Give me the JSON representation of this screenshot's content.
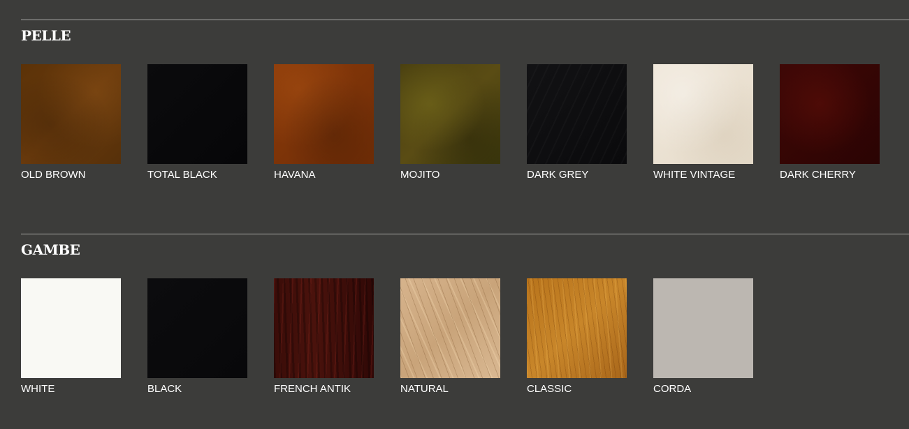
{
  "pelle": {
    "title": "PELLE",
    "items": [
      {
        "label": "OLD BROWN",
        "color": "#5e340a"
      },
      {
        "label": "TOTAL BLACK",
        "color": "#09090b"
      },
      {
        "label": "HAVANA",
        "color": "#7e340a"
      },
      {
        "label": "MOJITO",
        "color": "#4c4410"
      },
      {
        "label": "DARK GREY",
        "color": "#0e0e10"
      },
      {
        "label": "WHITE VINTAGE",
        "color": "#ebe2d3"
      },
      {
        "label": "DARK CHERRY",
        "color": "#360605"
      }
    ]
  },
  "gambe": {
    "title": "GAMBE",
    "items": [
      {
        "label": "WHITE",
        "color": "#f9f9f4"
      },
      {
        "label": "BLACK",
        "color": "#0a0a0c"
      },
      {
        "label": "FRENCH ANTIK",
        "color": "#3e0e09"
      },
      {
        "label": "NATURAL",
        "color": "#d2ae86"
      },
      {
        "label": "CLASSIC",
        "color": "#bc7a22"
      },
      {
        "label": "CORDA",
        "color": "#bcb7b1"
      }
    ]
  },
  "colors": {
    "background": "#3c3c3a",
    "rule": "#a9a9a6",
    "text": "#ffffff"
  }
}
